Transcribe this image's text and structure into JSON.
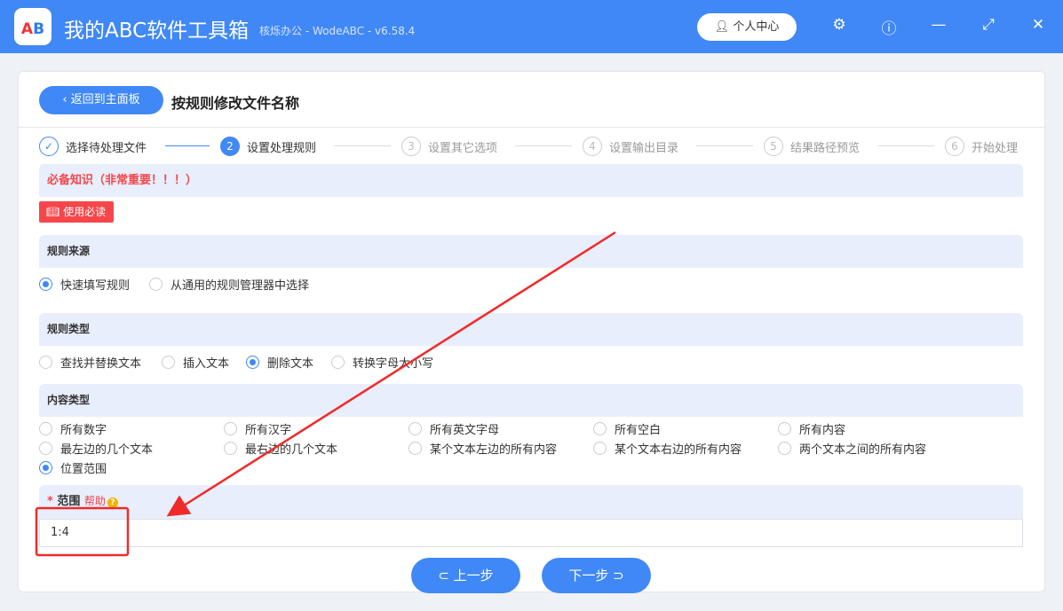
{
  "app": {
    "logo": "AB",
    "title": "我的ABC软件工具箱",
    "subtitle": "核烁办公 - WodeABC - v6.58.4",
    "user_center": "个人中心"
  },
  "header": {
    "back": "返回到主面板",
    "title": "按规则修改文件名称"
  },
  "steps": [
    {
      "n": "✓",
      "label": "选择待处理文件"
    },
    {
      "n": "2",
      "label": "设置处理规则"
    },
    {
      "n": "3",
      "label": "设置其它选项"
    },
    {
      "n": "4",
      "label": "设置输出目录"
    },
    {
      "n": "5",
      "label": "结果路径预览"
    },
    {
      "n": "6",
      "label": "开始处理"
    }
  ],
  "notice": {
    "title": "必备知识（非常重要！！！）",
    "button": "使用必读"
  },
  "rule_source": {
    "title": "规则来源",
    "options": [
      "快速填写规则",
      "从通用的规则管理器中选择"
    ],
    "selected": 0
  },
  "rule_type": {
    "title": "规则类型",
    "options": [
      "查找并替换文本",
      "插入文本",
      "删除文本",
      "转换字母大小写"
    ],
    "selected": 2
  },
  "content_type": {
    "title": "内容类型",
    "options": [
      "所有数字",
      "所有汉字",
      "所有英文字母",
      "所有空白",
      "所有内容",
      "最左边的几个文本",
      "最右边的几个文本",
      "某个文本左边的所有内容",
      "某个文本右边的所有内容",
      "两个文本之间的所有内容",
      "位置范围"
    ],
    "selected": 10
  },
  "range": {
    "required": "*",
    "label": "范围",
    "help": "帮助",
    "value": "1:4"
  },
  "nav": {
    "prev": "上一步",
    "next": "下一步"
  },
  "colors": {
    "accent": "#4088f5",
    "danger": "#f5474b"
  }
}
